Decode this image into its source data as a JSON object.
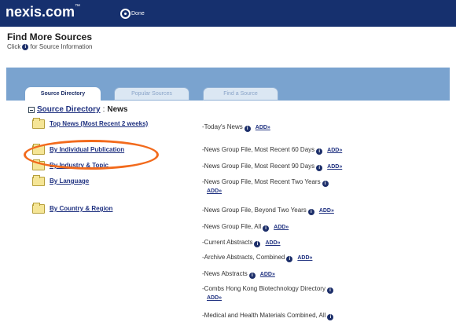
{
  "app": {
    "brand": "nexis.com",
    "brand_mark": "™",
    "done_label": "Done"
  },
  "header": {
    "title": "Find More Sources",
    "subtitle_pre": "Click",
    "subtitle_post": "for Source Information"
  },
  "tabs": [
    {
      "label": "Source Directory",
      "active": true
    },
    {
      "label": "Popular Sources",
      "active": false
    },
    {
      "label": "Find a Source",
      "active": false
    }
  ],
  "breadcrumb": {
    "root": "Source Directory",
    "separator": ":",
    "current": "News"
  },
  "categories": [
    {
      "label": "Top News (Most Recent 2 weeks)"
    },
    {
      "label": "By Individual Publication"
    },
    {
      "label": "By Industry & Topic"
    },
    {
      "label": "By Language"
    },
    {
      "label": "By Country & Region"
    }
  ],
  "sources": [
    {
      "name": "-Today's News",
      "add": "ADD»"
    },
    {
      "name": "-News Group File, Most Recent 60 Days",
      "add": "ADD»"
    },
    {
      "name": "-News Group File, Most Recent 90 Days",
      "add": "ADD»"
    },
    {
      "name": "-News Group File, Most Recent Two Years",
      "add": "ADD»"
    },
    {
      "name": "-News Group File, Beyond Two Years",
      "add": "ADD»"
    },
    {
      "name": "-News Group File, All",
      "add": "ADD»"
    },
    {
      "name": "-Current Abstracts",
      "add": "ADD»"
    },
    {
      "name": "-Archive Abstracts, Combined",
      "add": "ADD»"
    },
    {
      "name": "-News Abstracts",
      "add": "ADD»"
    },
    {
      "name": "-Combs Hong Kong Biotechnology Directory",
      "add": "ADD»"
    },
    {
      "name": "-Medical and Health Materials Combined, All",
      "add": ""
    }
  ],
  "info_icon_glyph": "i",
  "colors": {
    "topbar": "#16306e",
    "band": "#7aa3cf",
    "link": "#1f3180",
    "highlight": "#f26a1c",
    "folder": "#f5e596"
  }
}
